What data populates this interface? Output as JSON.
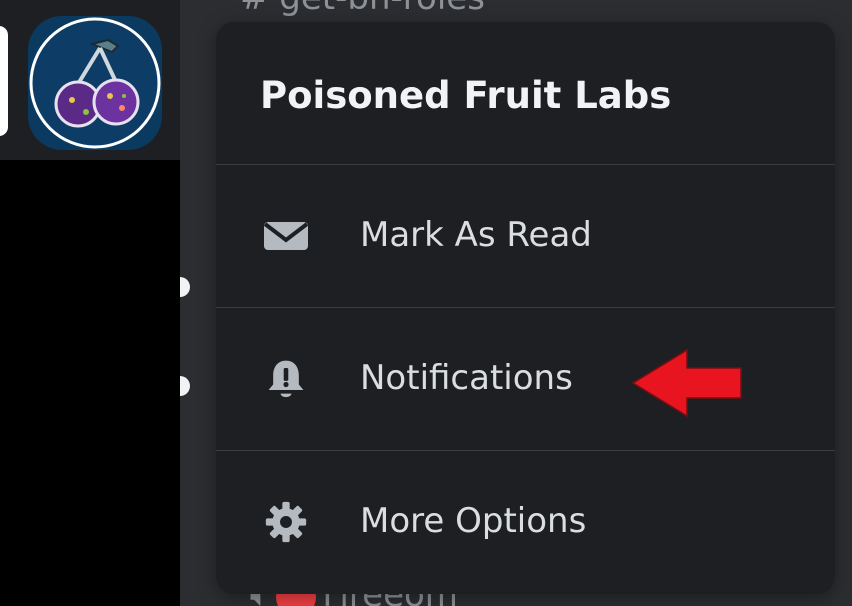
{
  "server_rail": {
    "selected_server_icon": "poisoned-cherry-server-icon"
  },
  "background_channels": {
    "top_channel": "# get-bh-roles",
    "bottom_channel": "Fireeom"
  },
  "context_menu": {
    "title": "Poisoned Fruit Labs",
    "items": [
      {
        "label": "Mark As Read",
        "icon": "envelope-icon"
      },
      {
        "label": "Notifications",
        "icon": "bell-alert-icon"
      },
      {
        "label": "More Options",
        "icon": "gear-icon"
      }
    ]
  },
  "annotation": {
    "arrow_color": "#e8141f",
    "points_to": "Notifications"
  },
  "colors": {
    "menu_background": "#1e1f22",
    "text": "#dbdee1",
    "title": "#f2f3f5",
    "icon": "#b5bac1"
  }
}
